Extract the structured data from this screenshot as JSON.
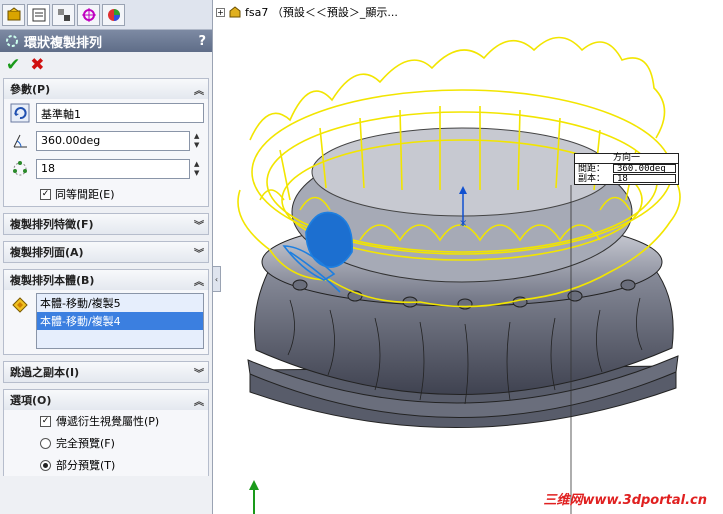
{
  "panel": {
    "tabs": [
      "feature-manager-icon",
      "property-manager-icon",
      "configuration-manager-icon",
      "dimxpert-icon",
      "appearance-icon"
    ],
    "title": "環狀複製排列",
    "help": "?",
    "ok": "✔",
    "cancel": "✖",
    "params": {
      "header": "參數(P)",
      "axis": "基準軸1",
      "angle": "360.00deg",
      "count": "18",
      "equal_spacing": "同等間距(E)"
    },
    "features_header": "複製排列特徵(F)",
    "faces_header": "複製排列面(A)",
    "bodies": {
      "header": "複製排列本體(B)",
      "items": [
        "本體-移動/複製5",
        "本體-移動/複製4"
      ]
    },
    "skip_header": "跳過之副本(I)",
    "options": {
      "header": "選項(O)",
      "propagate": "傳遞衍生視覺屬性(P)",
      "full_preview": "完全預覽(F)",
      "partial_preview": "部分預覽(T)"
    }
  },
  "tree": {
    "label": "fsa7 （預設＜＜預設＞_顯示..."
  },
  "callout": {
    "title": "方向一",
    "spacing_label": "間距：",
    "spacing_value": "360.00deg",
    "copies_label": "副本：",
    "copies_value": "18"
  },
  "watermark": "三维网www.3dportal.cn",
  "colors": {
    "preview": "#f2e500",
    "selection": "#1e7fe0",
    "body": "#5e6270"
  }
}
